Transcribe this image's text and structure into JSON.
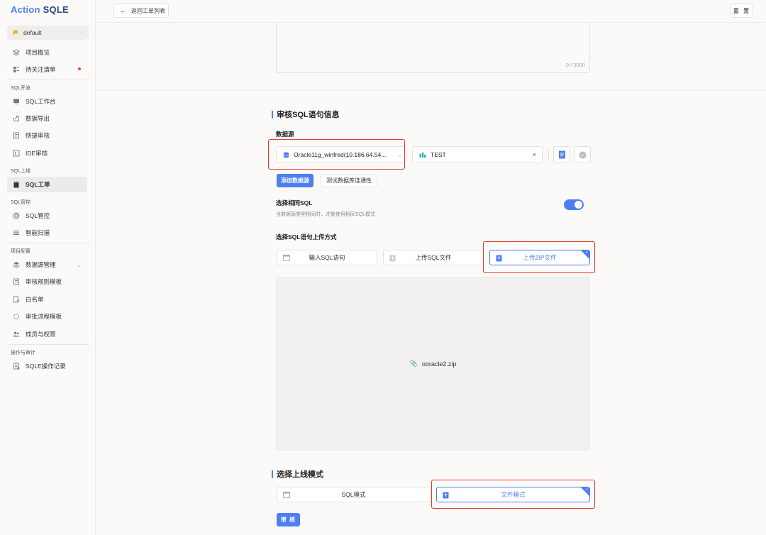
{
  "app": {
    "logo_part1": "Action",
    "logo_part2": "SQLE"
  },
  "project": {
    "name": "default",
    "flag_color": "#f0a81c"
  },
  "sidebar": {
    "items_top": [
      {
        "label": "项目概览",
        "icon": "layers-icon"
      },
      {
        "label": "待关注清单",
        "icon": "list-icon",
        "badge": "red-dot"
      }
    ],
    "section_dev": "SQL开发",
    "items_dev": [
      {
        "label": "SQL工作台",
        "icon": "monitor-icon"
      },
      {
        "label": "数据导出",
        "icon": "export-icon"
      },
      {
        "label": "快捷审核",
        "icon": "quick-audit-icon"
      },
      {
        "label": "IDE审核",
        "icon": "ide-icon"
      }
    ],
    "section_online": "SQL上线",
    "items_online": [
      {
        "label": "SQL工单",
        "icon": "clipboard-icon",
        "active": true
      }
    ],
    "section_control": "SQL管控",
    "items_control": [
      {
        "label": "SQL管控",
        "icon": "target-icon"
      },
      {
        "label": "智能扫描",
        "icon": "scan-icon"
      }
    ],
    "section_config": "项目配置",
    "items_config": [
      {
        "label": "数据源管理",
        "icon": "database-icon",
        "expandable": true
      },
      {
        "label": "审核规则模板",
        "icon": "rules-icon"
      },
      {
        "label": "白名单",
        "icon": "whitelist-icon"
      },
      {
        "label": "审批流程模板",
        "icon": "flow-icon"
      },
      {
        "label": "成员与权限",
        "icon": "members-icon"
      }
    ],
    "section_ops": "操作与审计",
    "items_ops": [
      {
        "label": "SQLE操作记录",
        "icon": "log-icon"
      }
    ]
  },
  "topbar": {
    "back_label": "返回工单列表",
    "reset_label": "重 置"
  },
  "description": {
    "char_count": "0 / 3000"
  },
  "audit_section": {
    "title": "审核SQL语句信息",
    "datasource_label": "数据源",
    "datasource_value": "Oracle11g_winfred(10.186.64.54...",
    "schema_value": "TEST",
    "add_datasource_label": "添加数据源",
    "test_connectivity_label": "测试数据库连通性",
    "same_sql_label": "选择相同SQL",
    "same_sql_hint": "当数据源类型相同时，才能使用相同SQL模式",
    "same_sql_enabled": true,
    "upload_method_label": "选择SQL语句上传方式",
    "upload_methods": [
      "输入SQL语句",
      "上传SQL文件",
      "上传ZIP文件"
    ],
    "upload_selected": "上传ZIP文件",
    "uploaded_file": "ooracle2.zip"
  },
  "mode_section": {
    "title": "选择上线模式",
    "modes": [
      "SQL模式",
      "文件模式"
    ],
    "selected": "文件模式",
    "submit_label": "审 核"
  },
  "colors": {
    "accent": "#4b7ff2",
    "highlight": "#e53a2a",
    "teal": "#27b3a6"
  }
}
